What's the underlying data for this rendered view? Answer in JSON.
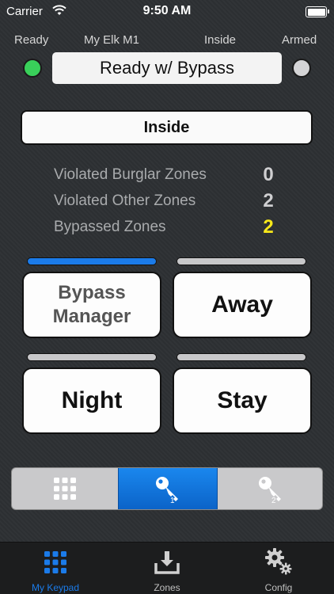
{
  "status_bar": {
    "carrier": "Carrier",
    "time": "9:50 AM"
  },
  "header": {
    "ready_label": "Ready",
    "system_label": "My Elk M1",
    "area_label": "Inside",
    "armed_label": "Armed",
    "status_text": "Ready w/ Bypass",
    "ready_led_color": "#39d05a",
    "armed_led_color": "#d4d4d6"
  },
  "mode": {
    "label": "Inside"
  },
  "stats": [
    {
      "label": "Violated Burglar Zones",
      "value": "0",
      "color": "#cfcfd1"
    },
    {
      "label": "Violated Other Zones",
      "value": "2",
      "color": "#cfcfd1"
    },
    {
      "label": "Bypassed Zones",
      "value": "2",
      "color": "#f7e81a"
    }
  ],
  "buttons": {
    "bypass_line1": "Bypass",
    "bypass_line2": "Manager",
    "away": "Away",
    "night": "Night",
    "stay": "Stay"
  },
  "segment": {
    "items": [
      {
        "icon": "keypad-grid-icon",
        "number": ""
      },
      {
        "icon": "key-icon",
        "number": "1",
        "selected": true
      },
      {
        "icon": "key-icon",
        "number": "2"
      }
    ]
  },
  "tabbar": {
    "tabs": [
      {
        "label": "My Keypad",
        "icon": "keypad-grid-icon",
        "active": true
      },
      {
        "label": "Zones",
        "icon": "download-tray-icon",
        "active": false
      },
      {
        "label": "Config",
        "icon": "gears-icon",
        "active": false
      }
    ],
    "accent": "#1b7be9"
  }
}
